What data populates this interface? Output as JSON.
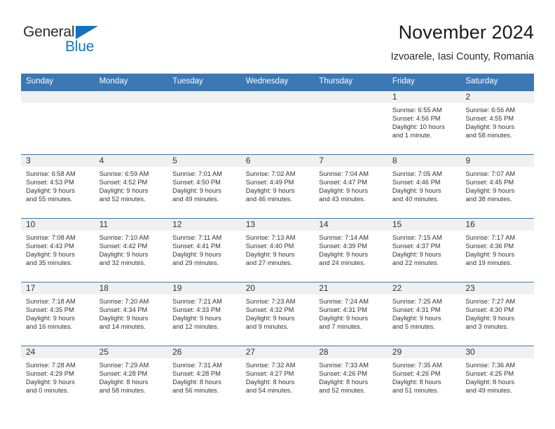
{
  "brand": {
    "name_part1": "General",
    "name_part2": "Blue",
    "accent_color": "#1173bd"
  },
  "header": {
    "title": "November 2024",
    "subtitle": "Izvoarele, Iasi County, Romania"
  },
  "theme": {
    "header_blue": "#3b78b4",
    "daynum_band": "#f0f0f0",
    "text": "#333333"
  },
  "weekday_headers": [
    "Sunday",
    "Monday",
    "Tuesday",
    "Wednesday",
    "Thursday",
    "Friday",
    "Saturday"
  ],
  "weeks": [
    [
      {
        "day": "",
        "empty": true
      },
      {
        "day": "",
        "empty": true
      },
      {
        "day": "",
        "empty": true
      },
      {
        "day": "",
        "empty": true
      },
      {
        "day": "",
        "empty": true
      },
      {
        "day": "1",
        "sunrise": "Sunrise: 6:55 AM",
        "sunset": "Sunset: 4:56 PM",
        "daylight1": "Daylight: 10 hours",
        "daylight2": "and 1 minute."
      },
      {
        "day": "2",
        "sunrise": "Sunrise: 6:56 AM",
        "sunset": "Sunset: 4:55 PM",
        "daylight1": "Daylight: 9 hours",
        "daylight2": "and 58 minutes."
      }
    ],
    [
      {
        "day": "3",
        "sunrise": "Sunrise: 6:58 AM",
        "sunset": "Sunset: 4:53 PM",
        "daylight1": "Daylight: 9 hours",
        "daylight2": "and 55 minutes."
      },
      {
        "day": "4",
        "sunrise": "Sunrise: 6:59 AM",
        "sunset": "Sunset: 4:52 PM",
        "daylight1": "Daylight: 9 hours",
        "daylight2": "and 52 minutes."
      },
      {
        "day": "5",
        "sunrise": "Sunrise: 7:01 AM",
        "sunset": "Sunset: 4:50 PM",
        "daylight1": "Daylight: 9 hours",
        "daylight2": "and 49 minutes."
      },
      {
        "day": "6",
        "sunrise": "Sunrise: 7:02 AM",
        "sunset": "Sunset: 4:49 PM",
        "daylight1": "Daylight: 9 hours",
        "daylight2": "and 46 minutes."
      },
      {
        "day": "7",
        "sunrise": "Sunrise: 7:04 AM",
        "sunset": "Sunset: 4:47 PM",
        "daylight1": "Daylight: 9 hours",
        "daylight2": "and 43 minutes."
      },
      {
        "day": "8",
        "sunrise": "Sunrise: 7:05 AM",
        "sunset": "Sunset: 4:46 PM",
        "daylight1": "Daylight: 9 hours",
        "daylight2": "and 40 minutes."
      },
      {
        "day": "9",
        "sunrise": "Sunrise: 7:07 AM",
        "sunset": "Sunset: 4:45 PM",
        "daylight1": "Daylight: 9 hours",
        "daylight2": "and 38 minutes."
      }
    ],
    [
      {
        "day": "10",
        "sunrise": "Sunrise: 7:08 AM",
        "sunset": "Sunset: 4:43 PM",
        "daylight1": "Daylight: 9 hours",
        "daylight2": "and 35 minutes."
      },
      {
        "day": "11",
        "sunrise": "Sunrise: 7:10 AM",
        "sunset": "Sunset: 4:42 PM",
        "daylight1": "Daylight: 9 hours",
        "daylight2": "and 32 minutes."
      },
      {
        "day": "12",
        "sunrise": "Sunrise: 7:11 AM",
        "sunset": "Sunset: 4:41 PM",
        "daylight1": "Daylight: 9 hours",
        "daylight2": "and 29 minutes."
      },
      {
        "day": "13",
        "sunrise": "Sunrise: 7:13 AM",
        "sunset": "Sunset: 4:40 PM",
        "daylight1": "Daylight: 9 hours",
        "daylight2": "and 27 minutes."
      },
      {
        "day": "14",
        "sunrise": "Sunrise: 7:14 AM",
        "sunset": "Sunset: 4:39 PM",
        "daylight1": "Daylight: 9 hours",
        "daylight2": "and 24 minutes."
      },
      {
        "day": "15",
        "sunrise": "Sunrise: 7:15 AM",
        "sunset": "Sunset: 4:37 PM",
        "daylight1": "Daylight: 9 hours",
        "daylight2": "and 22 minutes."
      },
      {
        "day": "16",
        "sunrise": "Sunrise: 7:17 AM",
        "sunset": "Sunset: 4:36 PM",
        "daylight1": "Daylight: 9 hours",
        "daylight2": "and 19 minutes."
      }
    ],
    [
      {
        "day": "17",
        "sunrise": "Sunrise: 7:18 AM",
        "sunset": "Sunset: 4:35 PM",
        "daylight1": "Daylight: 9 hours",
        "daylight2": "and 16 minutes."
      },
      {
        "day": "18",
        "sunrise": "Sunrise: 7:20 AM",
        "sunset": "Sunset: 4:34 PM",
        "daylight1": "Daylight: 9 hours",
        "daylight2": "and 14 minutes."
      },
      {
        "day": "19",
        "sunrise": "Sunrise: 7:21 AM",
        "sunset": "Sunset: 4:33 PM",
        "daylight1": "Daylight: 9 hours",
        "daylight2": "and 12 minutes."
      },
      {
        "day": "20",
        "sunrise": "Sunrise: 7:23 AM",
        "sunset": "Sunset: 4:32 PM",
        "daylight1": "Daylight: 9 hours",
        "daylight2": "and 9 minutes."
      },
      {
        "day": "21",
        "sunrise": "Sunrise: 7:24 AM",
        "sunset": "Sunset: 4:31 PM",
        "daylight1": "Daylight: 9 hours",
        "daylight2": "and 7 minutes."
      },
      {
        "day": "22",
        "sunrise": "Sunrise: 7:25 AM",
        "sunset": "Sunset: 4:31 PM",
        "daylight1": "Daylight: 9 hours",
        "daylight2": "and 5 minutes."
      },
      {
        "day": "23",
        "sunrise": "Sunrise: 7:27 AM",
        "sunset": "Sunset: 4:30 PM",
        "daylight1": "Daylight: 9 hours",
        "daylight2": "and 3 minutes."
      }
    ],
    [
      {
        "day": "24",
        "sunrise": "Sunrise: 7:28 AM",
        "sunset": "Sunset: 4:29 PM",
        "daylight1": "Daylight: 9 hours",
        "daylight2": "and 0 minutes."
      },
      {
        "day": "25",
        "sunrise": "Sunrise: 7:29 AM",
        "sunset": "Sunset: 4:28 PM",
        "daylight1": "Daylight: 8 hours",
        "daylight2": "and 58 minutes."
      },
      {
        "day": "26",
        "sunrise": "Sunrise: 7:31 AM",
        "sunset": "Sunset: 4:28 PM",
        "daylight1": "Daylight: 8 hours",
        "daylight2": "and 56 minutes."
      },
      {
        "day": "27",
        "sunrise": "Sunrise: 7:32 AM",
        "sunset": "Sunset: 4:27 PM",
        "daylight1": "Daylight: 8 hours",
        "daylight2": "and 54 minutes."
      },
      {
        "day": "28",
        "sunrise": "Sunrise: 7:33 AM",
        "sunset": "Sunset: 4:26 PM",
        "daylight1": "Daylight: 8 hours",
        "daylight2": "and 52 minutes."
      },
      {
        "day": "29",
        "sunrise": "Sunrise: 7:35 AM",
        "sunset": "Sunset: 4:26 PM",
        "daylight1": "Daylight: 8 hours",
        "daylight2": "and 51 minutes."
      },
      {
        "day": "30",
        "sunrise": "Sunrise: 7:36 AM",
        "sunset": "Sunset: 4:25 PM",
        "daylight1": "Daylight: 8 hours",
        "daylight2": "and 49 minutes."
      }
    ]
  ]
}
